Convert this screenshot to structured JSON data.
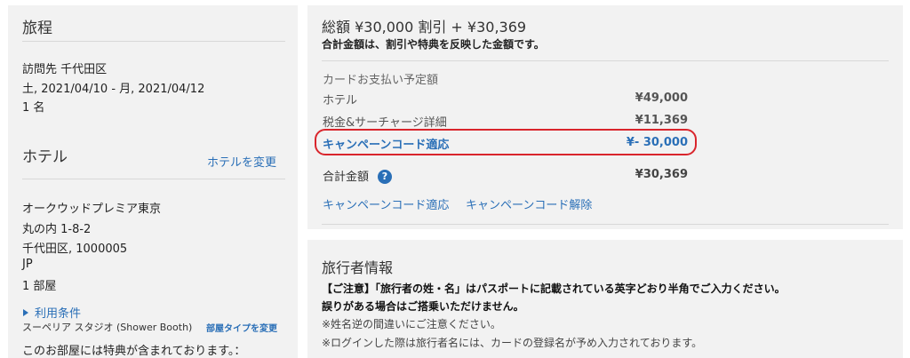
{
  "itinerary": {
    "title": "旅程",
    "destination": "訪問先 千代田区",
    "dates": "土, 2021/04/10 - 月, 2021/04/12",
    "guests": "1 名"
  },
  "hotel": {
    "title": "ホテル",
    "change_link": "ホテルを変更",
    "name": "オークウッドプレミア東京",
    "address_line1": "丸の内 1-8-2",
    "address_line2": "千代田区, 1000005",
    "country": "JP",
    "rooms": "1 部屋",
    "terms_link": "利用条件",
    "room_type": "スーペリア スタジオ (Shower Booth)",
    "change_room_type_link": "部屋タイプを変更",
    "benefits_note": "このお部屋には特典が含まれております。："
  },
  "summary": {
    "total_heading": "総額 ¥30,000 割引 + ¥30,369",
    "total_note": "合計金額は、割引や特典を反映した金額です。",
    "card_section_label": "カードお支払い予定額",
    "rows": [
      {
        "label": "ホテル",
        "value": "¥49,000"
      },
      {
        "label": "税金&サーチャージ詳細",
        "value": "¥11,369"
      },
      {
        "label": "キャンペーンコード適応",
        "value": "¥- 30,000"
      }
    ],
    "total_label": "合計金額",
    "total_help": "?",
    "total_value": "¥30,369",
    "apply_campaign_link": "キャンペーンコード適応",
    "remove_campaign_link": "キャンペーンコード解除"
  },
  "traveler": {
    "title": "旅行者情報",
    "notice_line1": "【ご注意】「旅行者の姓・名」はパスポートに記載されている英字どおり半角でご入力ください。",
    "notice_line2": "誤りがある場合はご搭乗いただけません。",
    "note1": "※姓名逆の間違いにご注意ください。",
    "note2": "※ログインした際は旅行者名には、カードの登録名が予め入力されております。"
  },
  "colors": {
    "link": "#2a6fb7",
    "highlight_border": "#d9252c",
    "panel_bg": "#f2f2f2"
  }
}
